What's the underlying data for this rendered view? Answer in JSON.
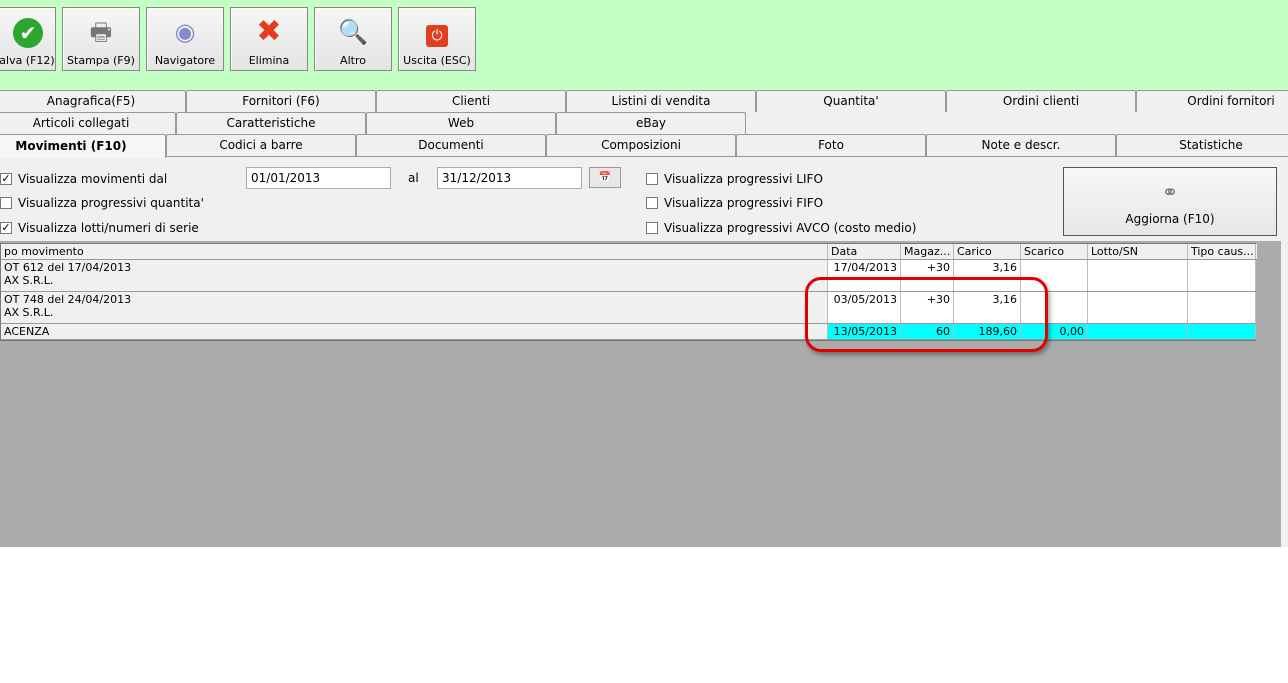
{
  "toolbar": {
    "buttons": [
      {
        "label": "alva (F12)",
        "icon": "check-icon"
      },
      {
        "label": "Stampa (F9)",
        "icon": "printer-icon"
      },
      {
        "label": "Navigatore",
        "icon": "compass-icon"
      },
      {
        "label": "Elimina",
        "icon": "delete-x-icon"
      },
      {
        "label": "Altro",
        "icon": "search-book-icon"
      },
      {
        "label": "Uscita (ESC)",
        "icon": "power-icon"
      }
    ]
  },
  "tabs": {
    "row1": [
      "Anagrafica(F5)",
      "Fornitori (F6)",
      "Clienti",
      "Listini di vendita",
      "Quantita'",
      "Ordini clienti",
      "Ordini fornitori"
    ],
    "row2": [
      "Articoli collegati",
      "Caratteristiche",
      "Web",
      "eBay"
    ],
    "row3": [
      "Movimenti (F10)",
      "Codici a barre",
      "Documenti",
      "Composizioni",
      "Foto",
      "Note e descr.",
      "Statistiche"
    ]
  },
  "filters": {
    "show_from": {
      "label": "Visualizza movimenti dal",
      "checked": true
    },
    "date_from": "01/01/2013",
    "al_label": "al",
    "date_to": "31/12/2013",
    "qty": {
      "label": "Visualizza progressivi quantita'",
      "checked": false
    },
    "lots": {
      "label": "Visualizza lotti/numeri di serie",
      "checked": true
    },
    "lifo": {
      "label": "Visualizza progressivi LIFO",
      "checked": false
    },
    "fifo": {
      "label": "Visualizza progressivi FIFO",
      "checked": false
    },
    "avco": {
      "label": "Visualizza progressivi AVCO (costo medio)",
      "checked": false
    },
    "refresh_label": "Aggiorna (F10)"
  },
  "grid": {
    "headers": [
      "po movimento",
      "Data",
      "Magaz...",
      "Carico",
      "Scarico",
      "Lotto/SN",
      "Tipo caus..."
    ],
    "rows": [
      {
        "desc1": "OT 612 del 17/04/2013",
        "desc2": "AX S.R.L.",
        "data": "17/04/2013",
        "magaz": "+30",
        "carico": "3,16",
        "scarico": "",
        "lotto": "",
        "tipo": ""
      },
      {
        "desc1": "OT 748 del 24/04/2013",
        "desc2": "AX S.R.L.",
        "data": "03/05/2013",
        "magaz": "+30",
        "carico": "3,16",
        "scarico": "",
        "lotto": "",
        "tipo": ""
      },
      {
        "desc1": "ACENZA",
        "desc2": "",
        "data": "13/05/2013",
        "magaz": "60",
        "carico": "189,60",
        "scarico": "0,00",
        "lotto": "",
        "tipo": ""
      }
    ]
  },
  "colors": {
    "toolbar_bg": "#c4ffc4",
    "highlight_row": "#00ffff",
    "annotation": "#e00000"
  }
}
